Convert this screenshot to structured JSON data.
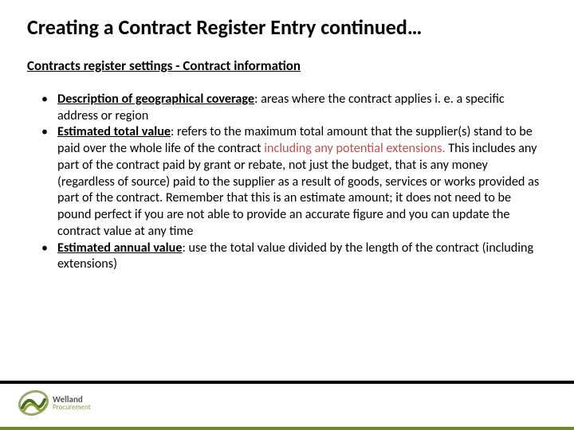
{
  "title": "Creating a Contract Register Entry continued…",
  "subtitle": "Contracts register settings - Contract information",
  "bullets": [
    {
      "label": "Description of geographical coverage",
      "text": ": areas where the contract applies i. e. a specific address or region"
    },
    {
      "label": "Estimated total value",
      "text_pre": ": refers to the maximum total amount that the supplier(s) stand to be paid over the whole life of the contract ",
      "red": "including any potential extensions.",
      "text_post": " This includes any part of the contract paid by grant or rebate, not just the budget, that is any money (regardless of source) paid to the supplier as a result of goods, services or works provided as part of the contract. Remember that this is an estimate amount; it does not need to be pound perfect if you are not able to provide an accurate figure and you can update the contract value at any time"
    },
    {
      "label": "Estimated annual value",
      "text": ": use the total value divided by the length of the contract (including extensions)"
    }
  ],
  "logo": {
    "line1": "Welland",
    "line2": "Procurement"
  }
}
